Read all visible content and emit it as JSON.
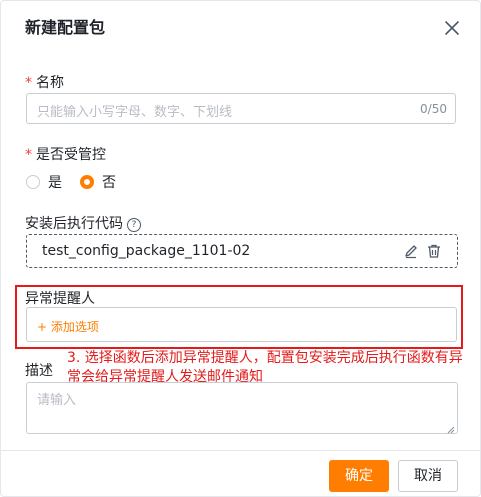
{
  "dialog": {
    "title": "新建配置包",
    "close_icon": "close-icon"
  },
  "form": {
    "name": {
      "required_mark": "*",
      "label": "名称",
      "placeholder": "只能输入小写字母、数字、下划线",
      "counter": "0/50"
    },
    "controlled": {
      "required_mark": "*",
      "label": "是否受管控",
      "options": [
        {
          "label": "是",
          "selected": false
        },
        {
          "label": "否",
          "selected": true
        }
      ]
    },
    "post_install": {
      "label": "安装后执行代码",
      "help_icon": "help-circle-icon",
      "value": "test_config_package_1101-02",
      "edit_icon": "pencil-icon",
      "delete_icon": "trash-icon"
    },
    "alert_recipients": {
      "label": "异常提醒人",
      "add_option": "+ 添加选项"
    },
    "description": {
      "label": "描述",
      "placeholder": "请输入"
    }
  },
  "annotation": {
    "text": "3. 选择函数后添加异常提醒人，配置包安装完成后执行函数有异常会给异常提醒人发送邮件通知",
    "color": "#e31b1b"
  },
  "footer": {
    "confirm_label": "确定",
    "cancel_label": "取消"
  },
  "colors": {
    "accent": "#ff7d00",
    "required": "#f53f3f",
    "highlight_border": "#e31b1b"
  }
}
